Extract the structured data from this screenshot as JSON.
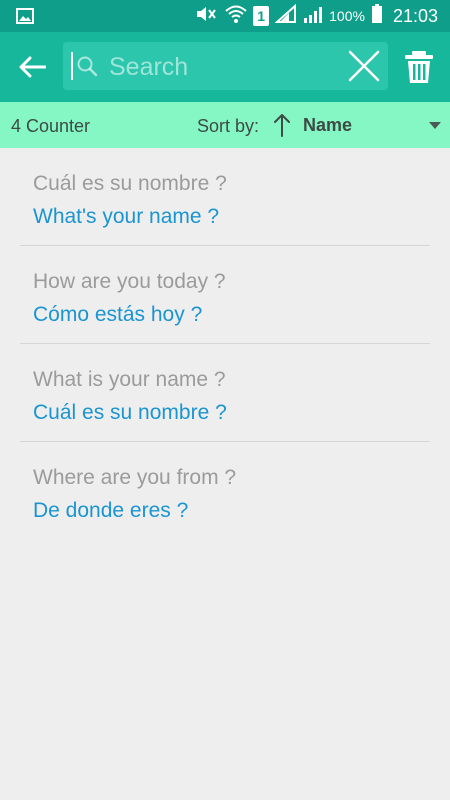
{
  "status_bar": {
    "battery_percent": "100%",
    "time": "21:03",
    "sim_slot": "1"
  },
  "header": {
    "back_icon": "arrow-left-icon",
    "search_placeholder": "Search",
    "search_value": "",
    "clear_icon": "close-icon",
    "delete_icon": "trash-icon"
  },
  "sort_bar": {
    "counter": "4 Counter",
    "sort_label": "Sort by:",
    "sort_direction_icon": "arrow-up-icon",
    "sort_value": "Name"
  },
  "phrases": [
    {
      "source": "Cuál es su nombre ?",
      "translation": "What's your name ?"
    },
    {
      "source": "How are you today ?",
      "translation": "Cómo estás hoy ?"
    },
    {
      "source": "What is your name ?",
      "translation": "Cuál es su nombre ?"
    },
    {
      "source": "Where are you from ?",
      "translation": "De donde eres ?"
    }
  ],
  "colors": {
    "status_bar": "#0f9e8a",
    "app_bar": "#17b79c",
    "sort_bar": "#85f7c4",
    "source_text": "#9b9b9b",
    "translation_text": "#1b95d1"
  }
}
